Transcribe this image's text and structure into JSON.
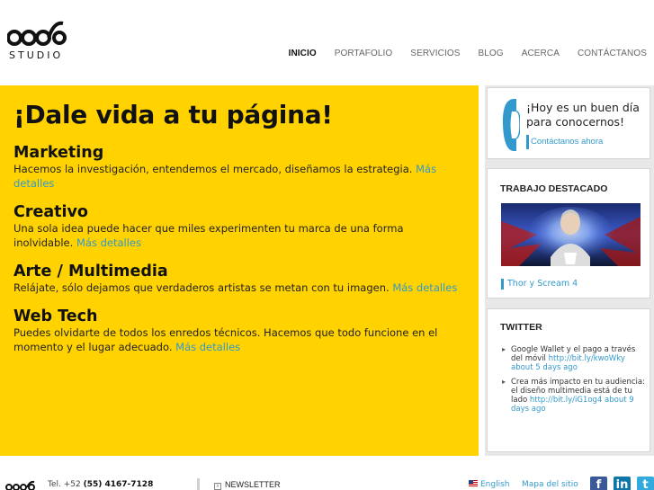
{
  "logo": {
    "text": "STUDIO"
  },
  "nav": {
    "items": [
      {
        "label": "INICIO"
      },
      {
        "label": "PORTAFOLIO"
      },
      {
        "label": "SERVICIOS"
      },
      {
        "label": "BLOG"
      },
      {
        "label": "ACERCA"
      },
      {
        "label": "CONTÁCTANOS"
      }
    ]
  },
  "main": {
    "title": "¡Dale vida a tu página!",
    "more_label": "Más detalles",
    "sections": [
      {
        "title": "Marketing",
        "text": "Hacemos la investigación, entendemos el mercado, diseñamos la estrategia.",
        "more": "Más detalles"
      },
      {
        "title": "Creativo",
        "text": "Una sola idea puede hacer que miles experimenten tu marca de una forma inolvidable.",
        "more": "Más detalles"
      },
      {
        "title": "Arte / Multimedia",
        "text": "Relájate, sólo dejamos que verdaderos artistas se metan con tu imagen.",
        "more": "Más detalles"
      },
      {
        "title": "Web Tech",
        "text": "Puedes olvidarte de todos los enredos técnicos. Hacemos que todo funcione en el momento y el lugar adecuado.",
        "more": "Más detalles"
      }
    ]
  },
  "sidebar": {
    "call": {
      "text": "¡Hoy es un buen día para conocernos!",
      "link": "Contáctanos ahora"
    },
    "work": {
      "title": "TRABAJO DESTACADO",
      "link": "Thor y Scream 4"
    },
    "twitter": {
      "title": "TWITTER",
      "tweets": [
        {
          "text": "Google Wallet y el pago a través del móvil",
          "link": "http://bit.ly/kwoWky",
          "time": "about 5 days ago"
        },
        {
          "text": "Crea más impacto en tu audiencia: el diseño multimedia está de tu lado",
          "link": "http://bit.ly/iG1og4",
          "time": "about 9 days ago"
        }
      ]
    }
  },
  "footer": {
    "tel_label": "Tel. +52",
    "tel_number": "(55) 4167-7128",
    "newsletter": "NEWSLETTER",
    "language": "English",
    "sitemap": "Mapa del sitio",
    "social": [
      "facebook-icon",
      "linkedin-icon",
      "twitter-icon"
    ]
  },
  "colors": {
    "accent_yellow": "#ffd200",
    "link_blue": "#3399cc"
  }
}
